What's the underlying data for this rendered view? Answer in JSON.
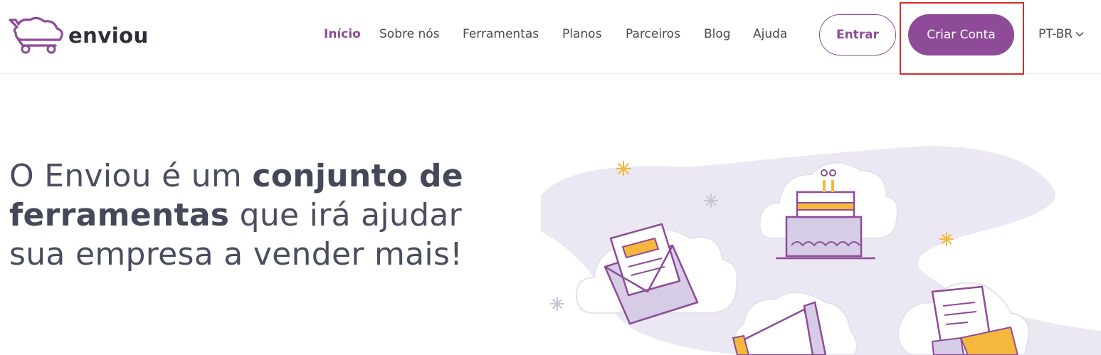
{
  "brand": {
    "name": "enviou",
    "icon": "cart-cloud-icon"
  },
  "nav": {
    "items": [
      {
        "label": "Início",
        "active": true
      },
      {
        "label": "Sobre nós",
        "active": false
      },
      {
        "label": "Ferramentas",
        "active": false
      },
      {
        "label": "Planos",
        "active": false
      },
      {
        "label": "Parceiros",
        "active": false
      },
      {
        "label": "Blog",
        "active": false
      },
      {
        "label": "Ajuda",
        "active": false
      }
    ]
  },
  "actions": {
    "login_label": "Entrar",
    "signup_label": "Criar Conta",
    "language_label": "PT-BR",
    "language_icon": "chevron-down-icon"
  },
  "hero": {
    "line1_prefix": "O Enviou é um ",
    "line1_bold": "conjunto de",
    "line2_bold": "ferramentas",
    "line2_suffix": " que irá ajudar",
    "line3": "sua empresa a vender mais!"
  },
  "colors": {
    "accent": "#8d4b98",
    "highlight": "#d42a2a",
    "illustration_yellow": "#f5b83d",
    "illustration_lavender": "#ebe8f3"
  }
}
